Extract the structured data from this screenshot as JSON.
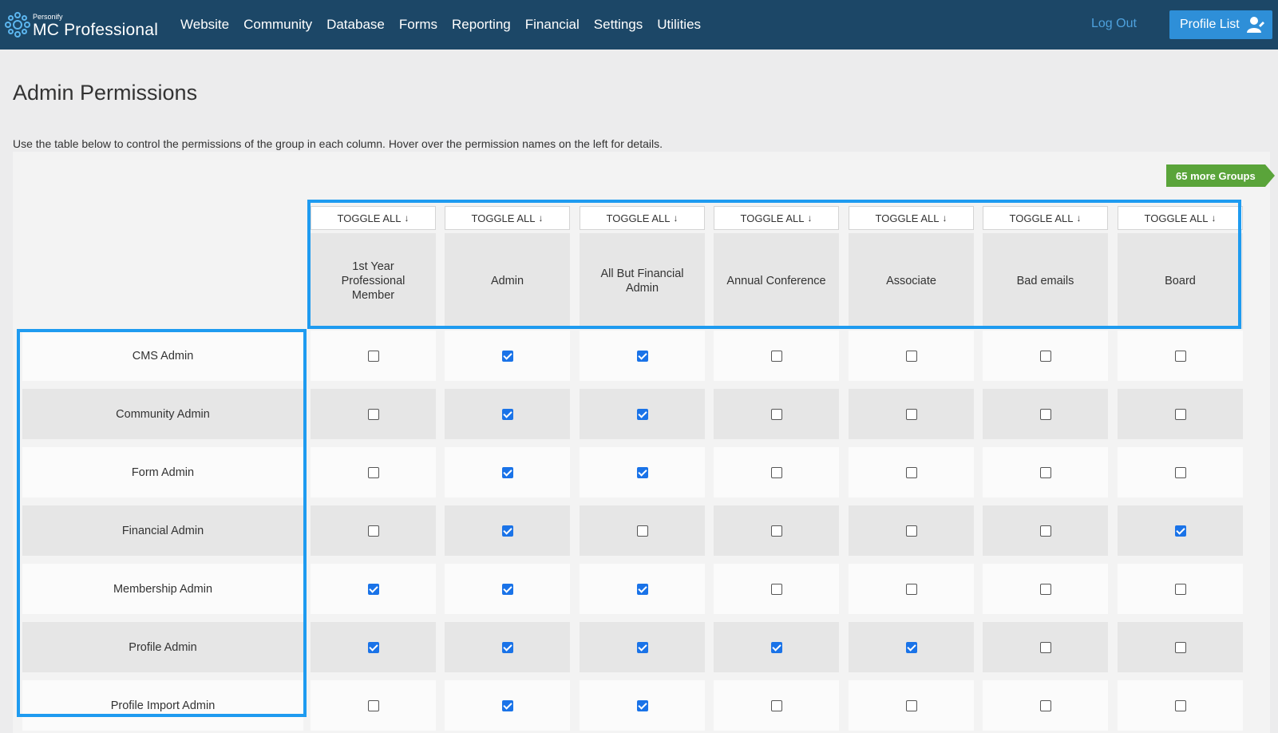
{
  "header": {
    "brand_small": "Personify",
    "brand_big": "MC Professional",
    "nav": [
      "Website",
      "Community",
      "Database",
      "Forms",
      "Reporting",
      "Financial",
      "Settings",
      "Utilities"
    ],
    "logout": "Log Out",
    "profile_list": "Profile List"
  },
  "page": {
    "title": "Admin Permissions",
    "intro": "Use the table below to control the permissions of the group in each column. Hover over the permission names on the left for details.",
    "more_groups": "65 more Groups",
    "toggle_label": "TOGGLE ALL",
    "toggle_arrow": "↓"
  },
  "groups": [
    "1st Year Professional Member",
    "Admin",
    "All But Financial Admin",
    "Annual Conference",
    "Associate",
    "Bad emails",
    "Board"
  ],
  "permissions": [
    {
      "name": "CMS Admin",
      "values": [
        false,
        true,
        true,
        false,
        false,
        false,
        false
      ]
    },
    {
      "name": "Community Admin",
      "values": [
        false,
        true,
        true,
        false,
        false,
        false,
        false
      ]
    },
    {
      "name": "Form Admin",
      "values": [
        false,
        true,
        true,
        false,
        false,
        false,
        false
      ]
    },
    {
      "name": "Financial Admin",
      "values": [
        false,
        true,
        false,
        false,
        false,
        false,
        true
      ]
    },
    {
      "name": "Membership Admin",
      "values": [
        true,
        true,
        true,
        false,
        false,
        false,
        false
      ]
    },
    {
      "name": "Profile Admin",
      "values": [
        true,
        true,
        true,
        true,
        true,
        false,
        false
      ]
    },
    {
      "name": "Profile Import Admin",
      "values": [
        false,
        true,
        true,
        false,
        false,
        false,
        false
      ]
    }
  ],
  "colors": {
    "topbar": "#1c4767",
    "accent": "#2e8fd8",
    "highlight": "#1e9bf0",
    "green": "#5aa43a"
  }
}
